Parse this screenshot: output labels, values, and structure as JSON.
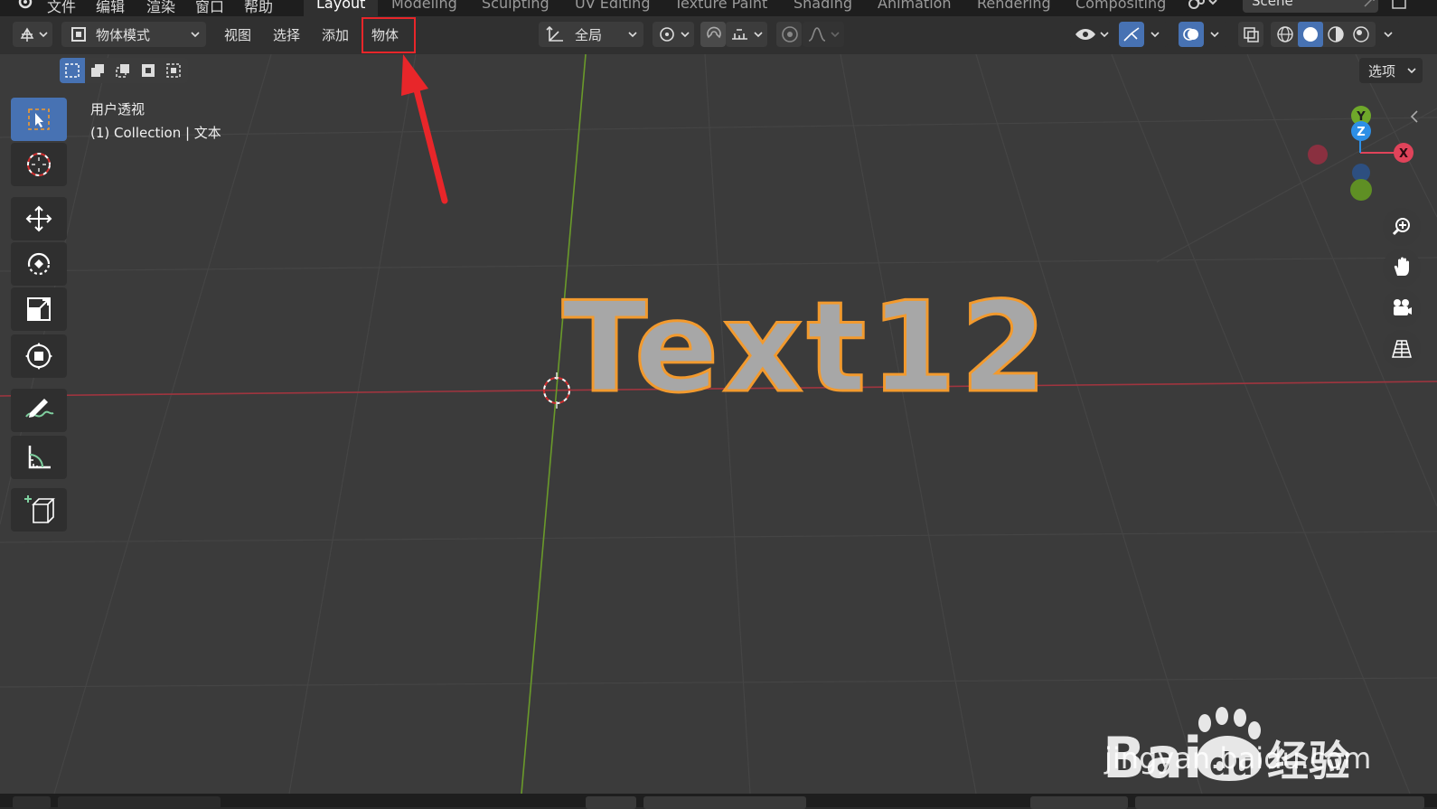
{
  "topbar": {
    "menus": [
      "文件",
      "编辑",
      "渲染",
      "窗口",
      "帮助"
    ],
    "workspaces": [
      "Layout",
      "Modeling",
      "Sculpting",
      "UV Editing",
      "Texture Paint",
      "Shading",
      "Animation",
      "Rendering",
      "Compositing"
    ],
    "active_workspace": "Layout",
    "scene_name": "Scene"
  },
  "header": {
    "mode_label": "物体模式",
    "menu_view": "视图",
    "menu_select": "选择",
    "menu_add": "添加",
    "menu_object": "物体",
    "orientation_label": "全局",
    "options_label": "选项"
  },
  "viewport": {
    "view_name": "用户透视",
    "collection_info": "(1) Collection | 文本",
    "text_object": "Text12",
    "gizmo": {
      "x": "X",
      "y": "Y",
      "z": "Z"
    }
  },
  "watermark": {
    "logo_text": "Bai",
    "logo_text2": "du",
    "logo_cn": "经验",
    "url": "jingyan.baidu.com"
  },
  "colors": {
    "accent_blue": "#4772b3",
    "highlight_red": "#e8262a",
    "selection_orange": "#f29a2e",
    "axis_x": "#e0435a",
    "axis_y": "#7fbf2a",
    "axis_z": "#2d8fe6"
  }
}
